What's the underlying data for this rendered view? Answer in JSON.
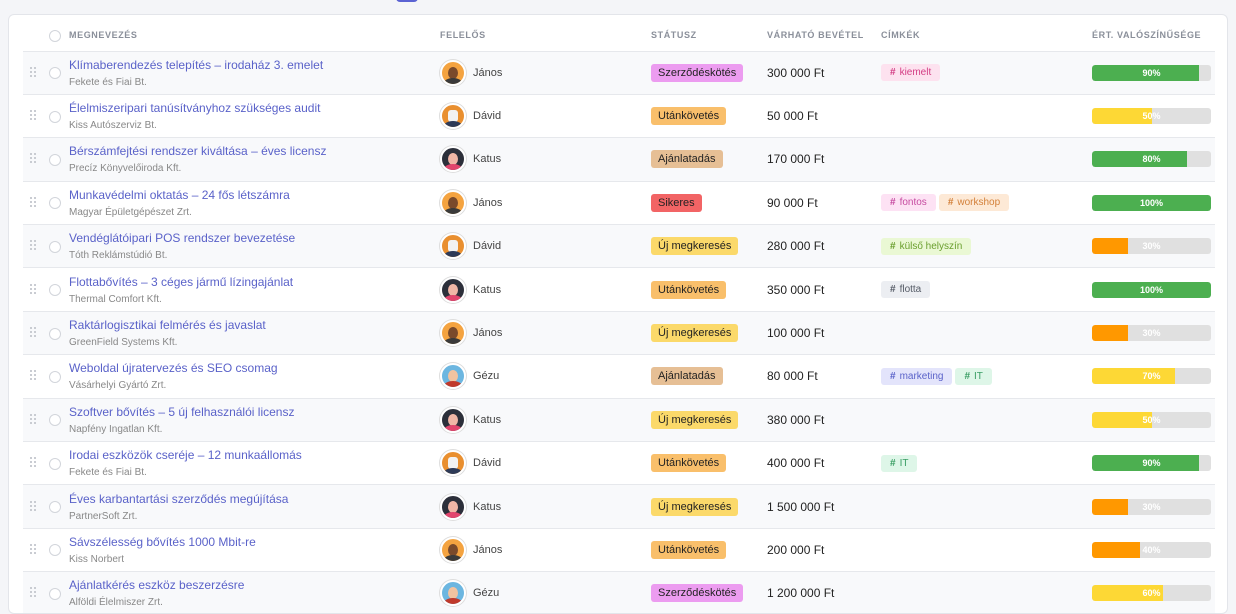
{
  "columns": {
    "name": "MEGNEVEZÉS",
    "owner": "FELELŐS",
    "status": "STÁTUSZ",
    "revenue": "VÁRHATÓ BEVÉTEL",
    "tags": "CÍMKÉK",
    "probability": "ÉRT. VALÓSZÍNŰSÉGE"
  },
  "colors": {
    "title_link": "#5a62c9",
    "status": {
      "Szerződéskötés": "#ec9cf0",
      "Utánkövetés": "#f9bf6b",
      "Ajánlatadás": "#e6bf95",
      "Sikeres": "#f26465",
      "Új megkeresés": "#fbd96a"
    },
    "progress": {
      "high": "#4caf50",
      "mid": "#fdd835",
      "low": "#ff9800"
    },
    "tags": {
      "kiemelt": {
        "bg": "#fde2ef",
        "fg": "#d33d84"
      },
      "fontos": {
        "bg": "#fde2f4",
        "fg": "#c64aa0"
      },
      "workshop": {
        "bg": "#fde9d6",
        "fg": "#d3803a"
      },
      "külső helyszín": {
        "bg": "#eaf8d4",
        "fg": "#6a9f2e"
      },
      "flotta": {
        "bg": "#eceef2",
        "fg": "#555b66"
      },
      "marketing": {
        "bg": "#e3e4fb",
        "fg": "#5a62c9"
      },
      "IT": {
        "bg": "#def6e8",
        "fg": "#3a9e64"
      }
    }
  },
  "rows": [
    {
      "title": "Klímaberendezés telepítés – irodaház 3. emelet",
      "company": "Fekete és Fiai Bt.",
      "owner": "János",
      "avatar": "janos-avatar",
      "status": "Szerződéskötés",
      "revenue": "300 000 Ft",
      "tags": [
        "kiemelt"
      ],
      "prob": 90,
      "prob_label": "90%"
    },
    {
      "title": "Élelmiszeripari tanúsítványhoz szükséges audit",
      "company": "Kiss Autószerviz Bt.",
      "owner": "Dávid",
      "avatar": "david-avatar",
      "status": "Utánkövetés",
      "revenue": "50 000 Ft",
      "tags": [],
      "prob": 50,
      "prob_label": "50%"
    },
    {
      "title": "Bérszámfejtési rendszer kiváltása – éves licensz",
      "company": "Precíz Könyvelőiroda Kft.",
      "owner": "Katus",
      "avatar": "katus-avatar",
      "status": "Ajánlatadás",
      "revenue": "170 000 Ft",
      "tags": [],
      "prob": 80,
      "prob_label": "80%"
    },
    {
      "title": "Munkavédelmi oktatás – 24 fős létszámra",
      "company": "Magyar Épületgépészet Zrt.",
      "owner": "János",
      "avatar": "janos-avatar",
      "status": "Sikeres",
      "revenue": "90 000 Ft",
      "tags": [
        "fontos",
        "workshop"
      ],
      "prob": 100,
      "prob_label": "100%"
    },
    {
      "title": "Vendéglátóipari POS rendszer bevezetése",
      "company": "Tóth Reklámstúdió Bt.",
      "owner": "Dávid",
      "avatar": "david-avatar",
      "status": "Új megkeresés",
      "revenue": "280 000 Ft",
      "tags": [
        "külső helyszín"
      ],
      "prob": 30,
      "prob_label": "30%"
    },
    {
      "title": "Flottabővítés – 3 céges jármű lízingajánlat",
      "company": "Thermal Comfort Kft.",
      "owner": "Katus",
      "avatar": "katus-avatar",
      "status": "Utánkövetés",
      "revenue": "350 000 Ft",
      "tags": [
        "flotta"
      ],
      "prob": 100,
      "prob_label": "100%"
    },
    {
      "title": "Raktárlogisztikai felmérés és javaslat",
      "company": "GreenField Systems Kft.",
      "owner": "János",
      "avatar": "janos-avatar",
      "status": "Új megkeresés",
      "revenue": "100 000 Ft",
      "tags": [],
      "prob": 30,
      "prob_label": "30%"
    },
    {
      "title": "Weboldal újratervezés és SEO csomag",
      "company": "Vásárhelyi Gyártó Zrt.",
      "owner": "Gézu",
      "avatar": "gezu-avatar",
      "status": "Ajánlatadás",
      "revenue": "80 000 Ft",
      "tags": [
        "marketing",
        "IT"
      ],
      "prob": 70,
      "prob_label": "70%"
    },
    {
      "title": "Szoftver bővítés – 5 új felhasználói licensz",
      "company": "Napfény Ingatlan Kft.",
      "owner": "Katus",
      "avatar": "katus-avatar",
      "status": "Új megkeresés",
      "revenue": "380 000 Ft",
      "tags": [],
      "prob": 50,
      "prob_label": "50%"
    },
    {
      "title": "Irodai eszközök cseréje – 12 munkaállomás",
      "company": "Fekete és Fiai Bt.",
      "owner": "Dávid",
      "avatar": "david-avatar",
      "status": "Utánkövetés",
      "revenue": "400 000 Ft",
      "tags": [
        "IT"
      ],
      "prob": 90,
      "prob_label": "90%"
    },
    {
      "title": "Éves karbantartási szerződés megújítása",
      "company": "PartnerSoft Zrt.",
      "owner": "Katus",
      "avatar": "katus-avatar",
      "status": "Új megkeresés",
      "revenue": "1 500 000 Ft",
      "tags": [],
      "prob": 30,
      "prob_label": "30%"
    },
    {
      "title": "Sávszélesség bővítés 1000 Mbit-re",
      "company": "Kiss Norbert",
      "owner": "János",
      "avatar": "janos-avatar",
      "status": "Utánkövetés",
      "revenue": "200 000 Ft",
      "tags": [],
      "prob": 40,
      "prob_label": "40%"
    },
    {
      "title": "Ajánlatkérés eszköz beszerzésre",
      "company": "Alföldi Élelmiszer Zrt.",
      "owner": "Gézu",
      "avatar": "gezu-avatar",
      "status": "Szerződéskötés",
      "revenue": "1 200 000 Ft",
      "tags": [],
      "prob": 60,
      "prob_label": "60%"
    }
  ]
}
